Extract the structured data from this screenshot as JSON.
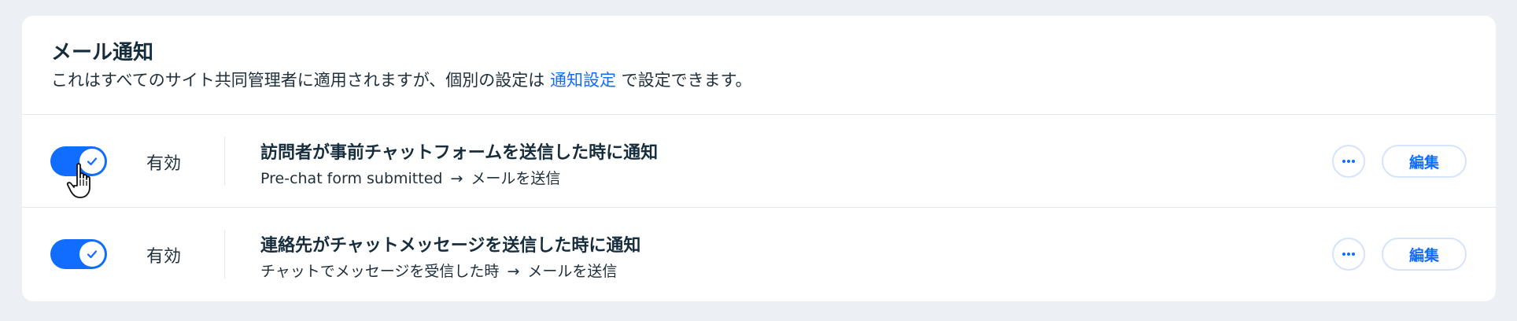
{
  "header": {
    "title": "メール通知",
    "subtitle_before": "これはすべてのサイト共同管理者に適用されますが、個別の設定は",
    "subtitle_link": "通知設定",
    "subtitle_after": "で設定できます。"
  },
  "rows": [
    {
      "enabled": true,
      "status": "有効",
      "title": "訪問者が事前チャットフォームを送信した時に通知",
      "trigger": "Pre-chat form submitted",
      "arrow": "→",
      "action": "メールを送信",
      "more_label": "···",
      "edit_label": "編集"
    },
    {
      "enabled": true,
      "status": "有効",
      "title": "連絡先がチャットメッセージを送信した時に通知",
      "trigger": "チャットでメッセージを受信した時",
      "arrow": "→",
      "action": "メールを送信",
      "more_label": "···",
      "edit_label": "編集"
    }
  ],
  "colors": {
    "accent": "#116dff",
    "background": "#eceff3",
    "text": "#20303c"
  },
  "icons": [
    "check-icon",
    "more-icon",
    "hand-pointer-icon"
  ]
}
